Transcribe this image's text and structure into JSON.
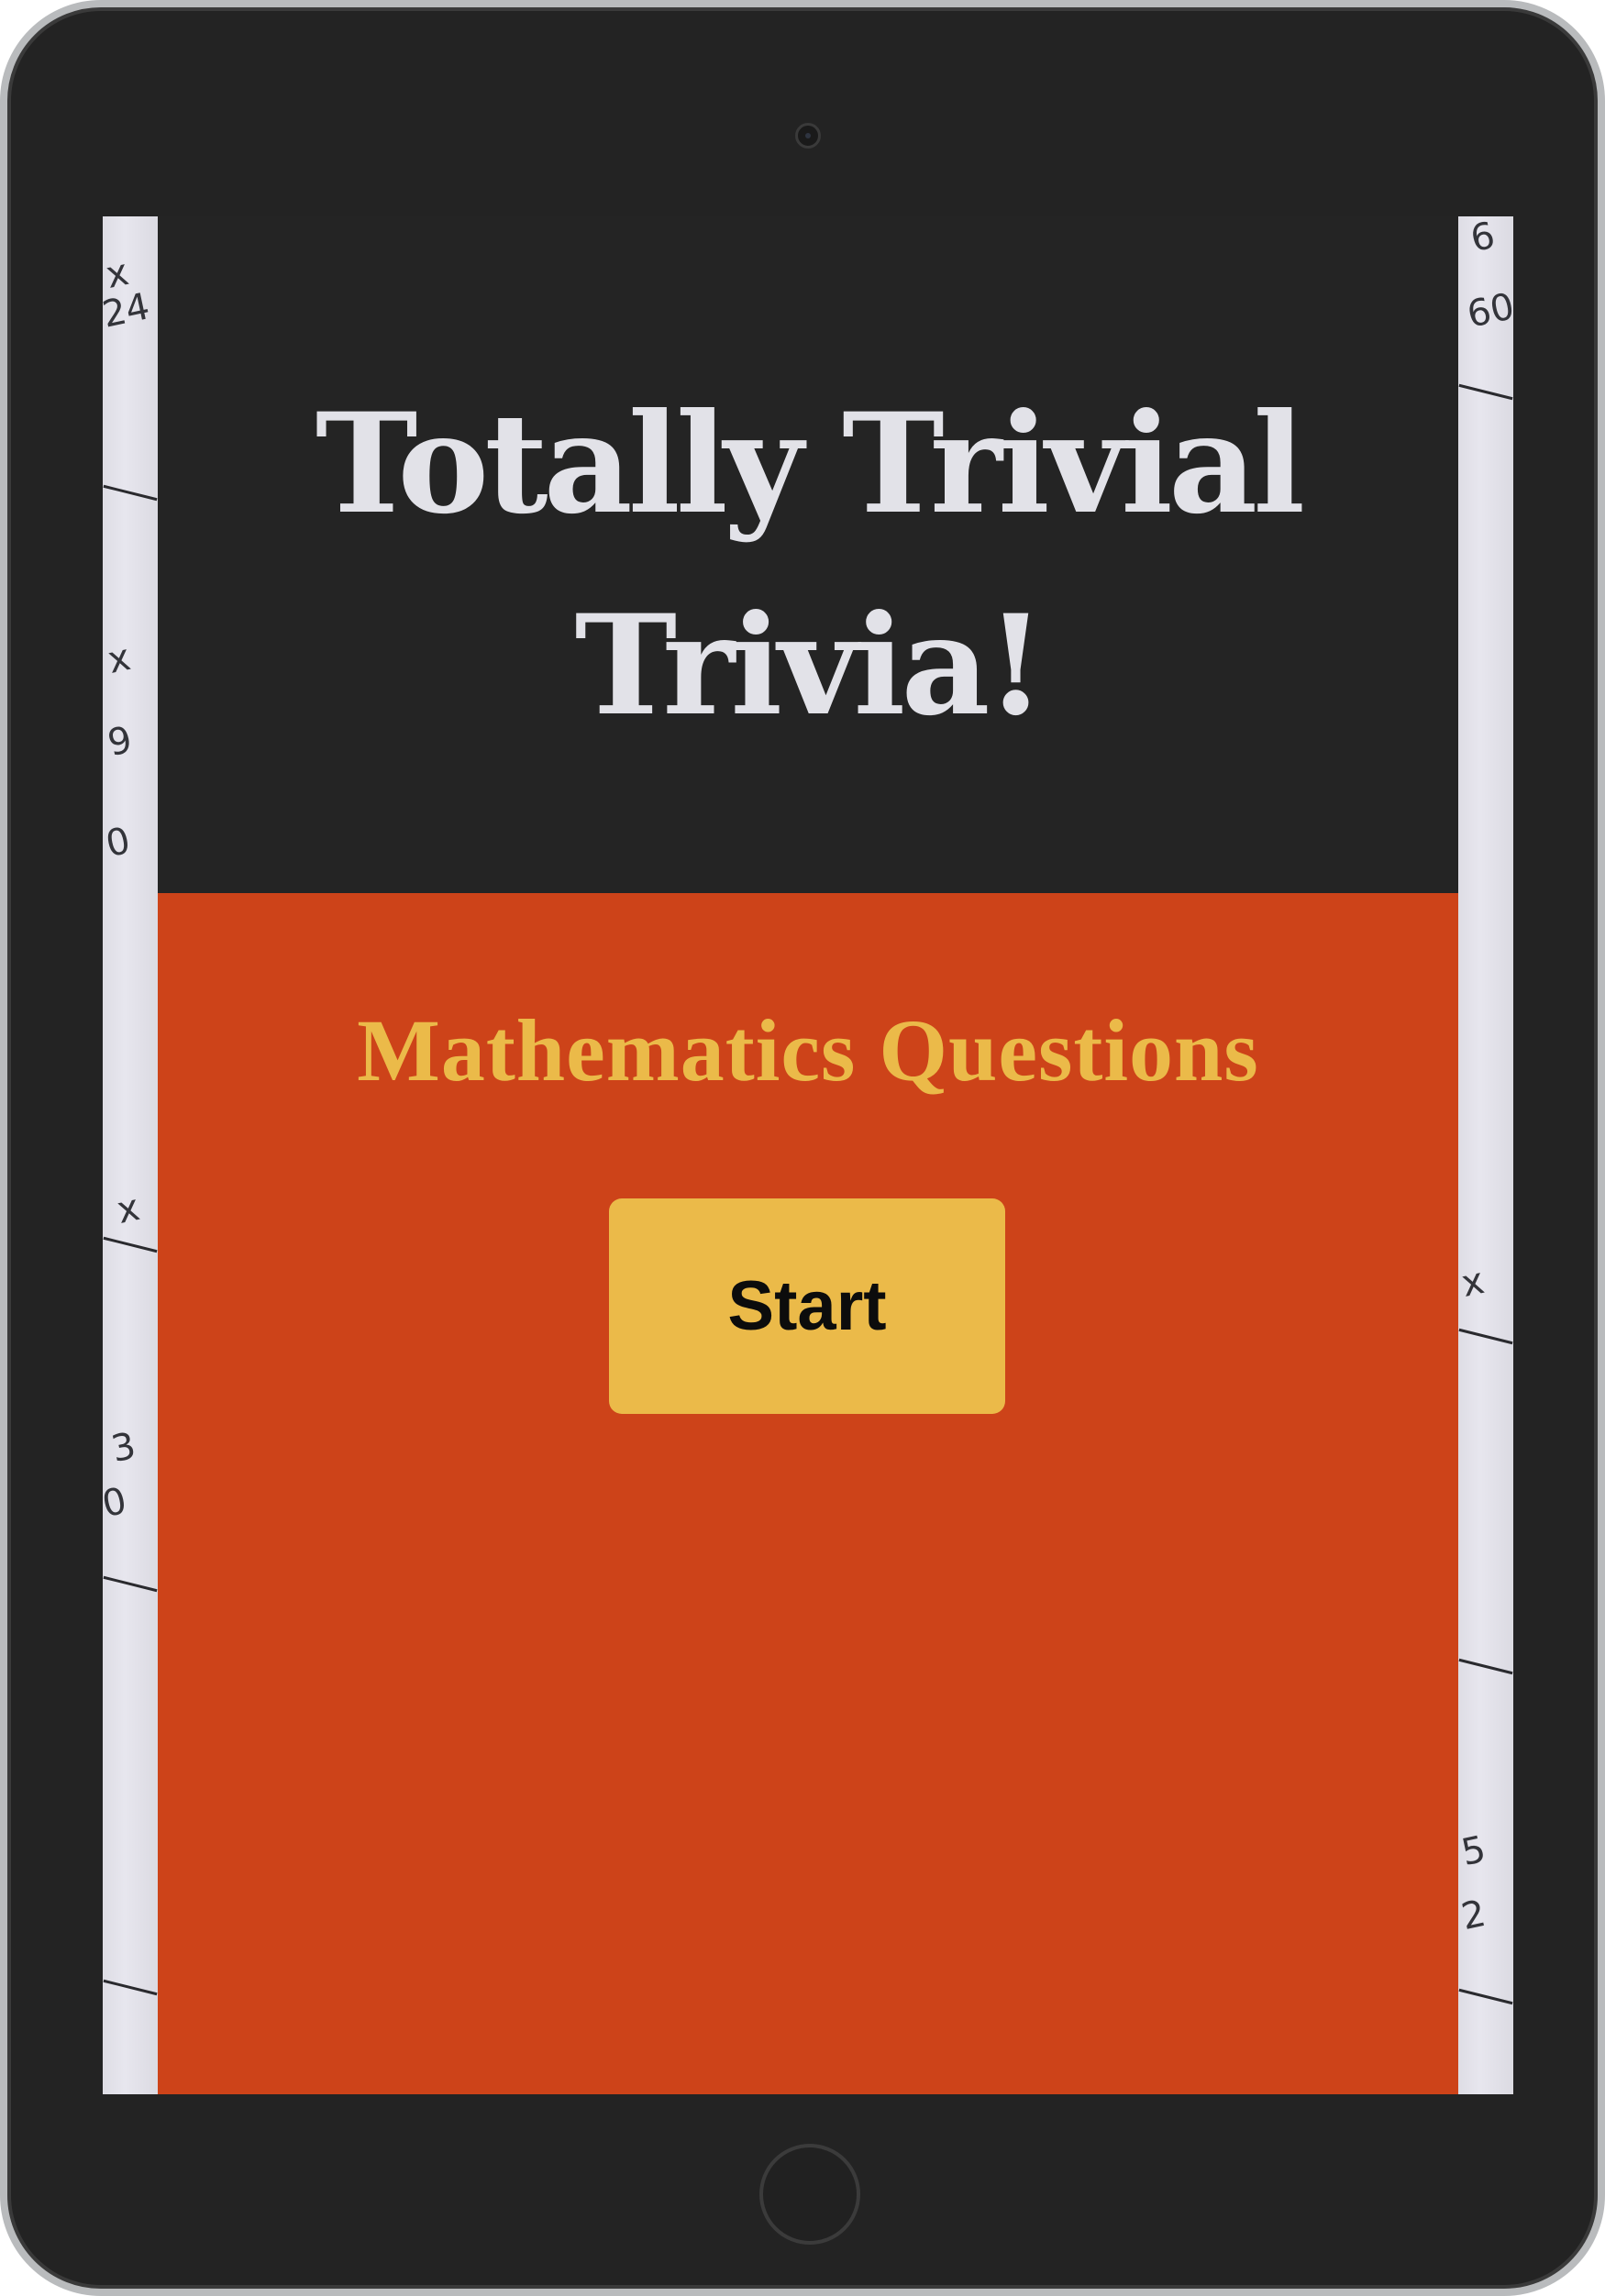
{
  "app": {
    "title_line1": "Totally Trivial",
    "title_line2": "Trivia!",
    "subtitle": "Mathematics Questions",
    "start_label": "Start"
  },
  "colors": {
    "header_bg": "#242424",
    "body_bg": "#cd4319",
    "accent": "#ebba49",
    "title_text": "#e2e2e8",
    "device_frame": "#232323"
  },
  "background": {
    "left_marks": [
      "x",
      "24",
      "x",
      "9",
      "0",
      "x",
      "3",
      "0"
    ],
    "right_marks": [
      "6",
      "60",
      "x",
      "5",
      "2"
    ]
  }
}
